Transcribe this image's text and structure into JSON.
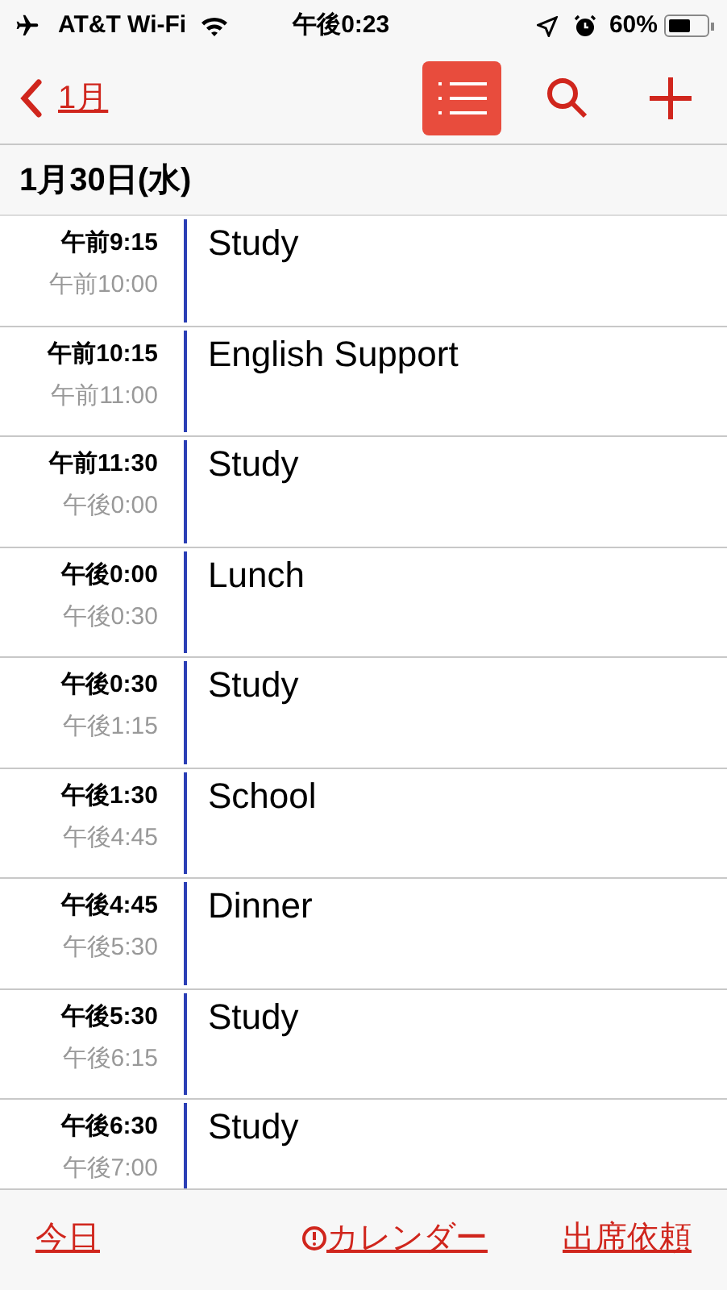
{
  "status_bar": {
    "carrier": "AT&T Wi-Fi",
    "time": "午後0:23",
    "battery": "60%"
  },
  "nav": {
    "back_label": "1月",
    "list_view": {
      "selected": true
    }
  },
  "day_header": "1月30日(水)",
  "events": [
    {
      "start": "午前9:15",
      "end": "午前10:00",
      "title": "Study",
      "color": "#2b3fb5"
    },
    {
      "start": "午前10:15",
      "end": "午前11:00",
      "title": "English Support",
      "color": "#2b3fb5"
    },
    {
      "start": "午前11:30",
      "end": "午後0:00",
      "title": "Study",
      "color": "#2b3fb5"
    },
    {
      "start": "午後0:00",
      "end": "午後0:30",
      "title": "Lunch",
      "color": "#2b3fb5"
    },
    {
      "start": "午後0:30",
      "end": "午後1:15",
      "title": "Study",
      "color": "#2b3fb5"
    },
    {
      "start": "午後1:30",
      "end": "午後4:45",
      "title": "School",
      "color": "#2b3fb5"
    },
    {
      "start": "午後4:45",
      "end": "午後5:30",
      "title": "Dinner",
      "color": "#2b3fb5"
    },
    {
      "start": "午後5:30",
      "end": "午後6:15",
      "title": "Study",
      "color": "#2b3fb5"
    },
    {
      "start": "午後6:30",
      "end": "午後7:00",
      "title": "Study",
      "color": "#2b3fb5"
    }
  ],
  "toolbar": {
    "today": "今日",
    "calendars": "カレンダー",
    "calendars_alert": true,
    "inbox": "出席依頼"
  }
}
